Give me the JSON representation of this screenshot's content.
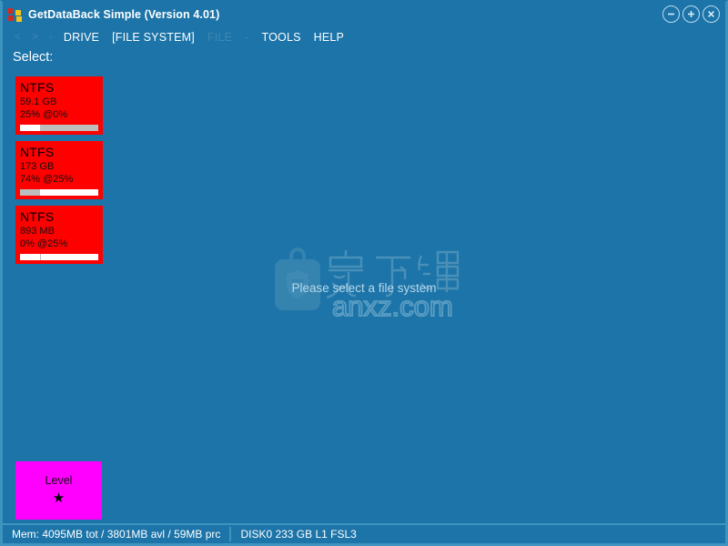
{
  "window": {
    "title": "GetDataBack Simple (Version 4.01)",
    "icon": "puzzle-pieces-icon",
    "background_color": "#1c74a8",
    "border_color": "#3e93bf",
    "controls": [
      {
        "name": "minimize",
        "glyph": "−"
      },
      {
        "name": "maximize",
        "glyph": "+"
      },
      {
        "name": "close",
        "glyph": "×"
      }
    ]
  },
  "menubar": {
    "items": [
      {
        "label": "<",
        "state": "dim",
        "kind": "nav"
      },
      {
        "label": ">",
        "state": "dim",
        "kind": "nav"
      },
      {
        "label": "-",
        "state": "dim",
        "kind": "nav"
      },
      {
        "label": "DRIVE",
        "state": "active",
        "kind": "menu"
      },
      {
        "label": "[FILE SYSTEM]",
        "state": "active",
        "kind": "menu"
      },
      {
        "label": "FILE",
        "state": "dim",
        "kind": "menu"
      },
      {
        "label": "-",
        "state": "dim",
        "kind": "menu"
      },
      {
        "label": "TOOLS",
        "state": "active",
        "kind": "menu"
      },
      {
        "label": "HELP",
        "state": "active",
        "kind": "menu"
      }
    ]
  },
  "main": {
    "select_label": "Select:",
    "center_message": "Please select a file system",
    "watermark_text": "anxz.com",
    "watermark_cjk": "安下载",
    "file_systems": [
      {
        "type": "NTFS",
        "size": "59.1 GB",
        "percent": "25% @0%",
        "color": "#fe0000",
        "bar_start_pct": 0,
        "bar_fill_pct": 25
      },
      {
        "type": "NTFS",
        "size": "173 GB",
        "percent": "74% @25%",
        "color": "#fe0000",
        "bar_start_pct": 25,
        "bar_fill_pct": 75
      },
      {
        "type": "NTFS",
        "size": "893 MB",
        "percent": "0% @25%",
        "color": "#fe0000",
        "bar_start_pct": 0,
        "bar_fill_pct": 100,
        "bar_tick_pct": 25
      }
    ],
    "level_button": {
      "label": "Level",
      "star": "★",
      "color": "#ff00ff"
    }
  },
  "statusbar": {
    "memory": "Mem: 4095MB tot / 3801MB avl / 59MB prc",
    "disk": "DISK0 233 GB L1 FSL3"
  }
}
